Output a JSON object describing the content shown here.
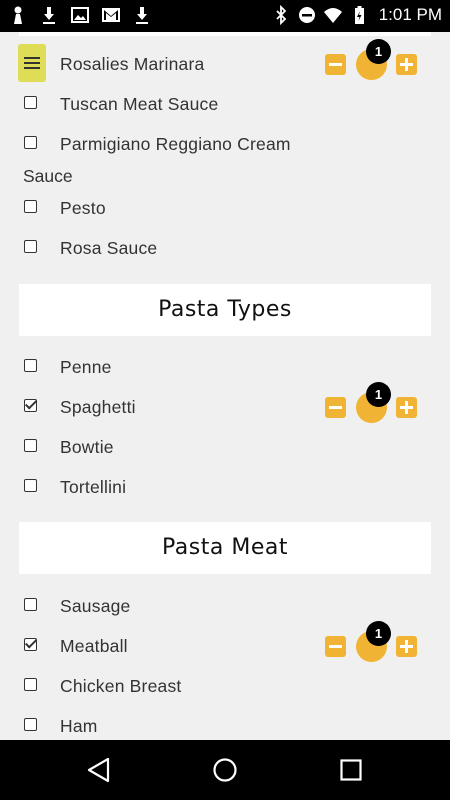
{
  "status_bar": {
    "time": "1:01 PM",
    "left_icons": [
      "notification-person-icon",
      "download-icon",
      "image-icon",
      "gmail-icon",
      "download-icon"
    ],
    "right_icons": [
      "bluetooth-icon",
      "do-not-disturb-icon",
      "wifi-icon",
      "battery-icon"
    ]
  },
  "sauce_section": {
    "items": [
      {
        "label": "Rosalies Marinara",
        "checked": false,
        "quantity": "1"
      },
      {
        "label": "Tuscan Meat Sauce",
        "checked": false
      },
      {
        "label": "Parmigiano Reggiano Cream",
        "label_continued": "Sauce",
        "checked": false
      },
      {
        "label": "Pesto",
        "checked": false
      },
      {
        "label": "Rosa Sauce",
        "checked": false
      }
    ]
  },
  "pasta_types": {
    "title": "Pasta Types",
    "items": [
      {
        "label": "Penne",
        "checked": false
      },
      {
        "label": "Spaghetti",
        "checked": true,
        "quantity": "1"
      },
      {
        "label": "Bowtie",
        "checked": false
      },
      {
        "label": "Tortellini",
        "checked": false
      }
    ]
  },
  "pasta_meat": {
    "title": "Pasta Meat",
    "items": [
      {
        "label": "Sausage",
        "checked": false
      },
      {
        "label": "Meatball",
        "checked": true,
        "quantity": "1"
      },
      {
        "label": "Chicken Breast",
        "checked": false
      },
      {
        "label": "Ham",
        "checked": false
      }
    ]
  },
  "colors": {
    "accent": "#f0b334",
    "menu_button": "#dedd55",
    "background": "#f0f0f0",
    "badge": "#000000"
  },
  "nav_bar": {
    "icons": [
      "back-icon",
      "home-icon",
      "recents-icon"
    ]
  }
}
